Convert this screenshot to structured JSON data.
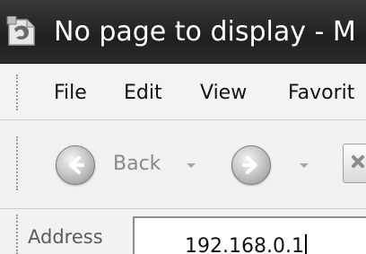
{
  "window": {
    "title": "No page to display - M"
  },
  "menu": {
    "items": [
      "File",
      "Edit",
      "View",
      "Favorit"
    ]
  },
  "toolbar": {
    "back_label": "Back"
  },
  "address": {
    "label": "Address",
    "value": "192.168.0.1"
  },
  "icons": {
    "app": "ie-page-icon",
    "back": "back-arrow-icon",
    "forward": "forward-arrow-icon",
    "stop": "stop-icon"
  },
  "colors": {
    "titlebar": "#2a2a2a",
    "chrome": "#f2f2f0"
  }
}
